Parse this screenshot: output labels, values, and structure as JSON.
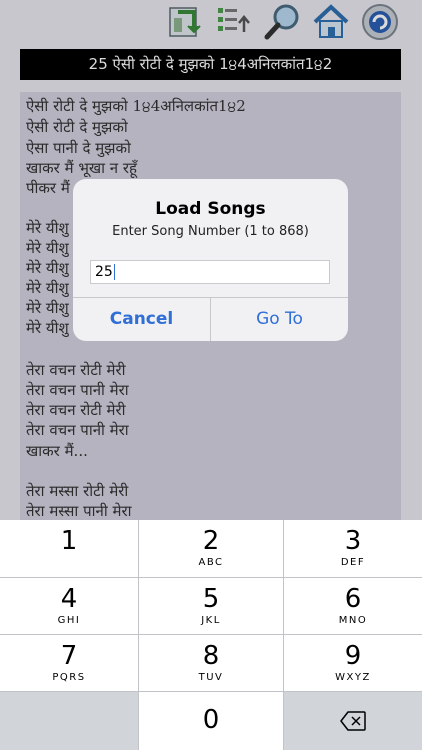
{
  "toolbar": {
    "icons": [
      "refresh-icon",
      "list-up-icon",
      "search-icon",
      "home-icon",
      "settings-icon"
    ]
  },
  "title_bar": {
    "text": "25 ऐसी रोटी दे मुझको 1੪4अनिलकांत1੪2"
  },
  "song": {
    "lines": [
      "ऐसी रोटी दे मुझको 1੪4अनिलकांत1੪2",
      "ऐसी रोटी दे मुझको",
      "ऐसा पानी दे मुझको",
      "खाकर मैं भूखा न रहूँ",
      "पीकर मैं",
      "",
      "मेरे यीशु",
      "मेरे यीशु",
      "मेरे यीशु",
      "मेरे यीशु",
      "मेरे यीशु",
      "मेरे यीशु",
      "",
      "तेरा वचन रोटी मेरी",
      "तेरा वचन पानी मेरा",
      "तेरा वचन रोटी मेरी",
      "तेरा वचन पानी मेरा",
      "खाकर मैं...",
      "",
      "तेरा मस्सा रोटी मेरी",
      "तेरा मस्सा पानी मेरा"
    ]
  },
  "alert": {
    "title": "Load Songs",
    "message": "Enter Song Number (1 to 868)",
    "input_value": "25",
    "cancel_label": "Cancel",
    "goto_label": "Go To",
    "accent_color": "#2f6fd6"
  },
  "keypad": {
    "keys": [
      {
        "num": "1",
        "letters": ""
      },
      {
        "num": "2",
        "letters": "ABC"
      },
      {
        "num": "3",
        "letters": "DEF"
      },
      {
        "num": "4",
        "letters": "GHI"
      },
      {
        "num": "5",
        "letters": "JKL"
      },
      {
        "num": "6",
        "letters": "MNO"
      },
      {
        "num": "7",
        "letters": "PQRS"
      },
      {
        "num": "8",
        "letters": "TUV"
      },
      {
        "num": "9",
        "letters": "WXYZ"
      },
      {
        "num": "0",
        "letters": ""
      }
    ],
    "delete_icon": "backspace-icon"
  }
}
